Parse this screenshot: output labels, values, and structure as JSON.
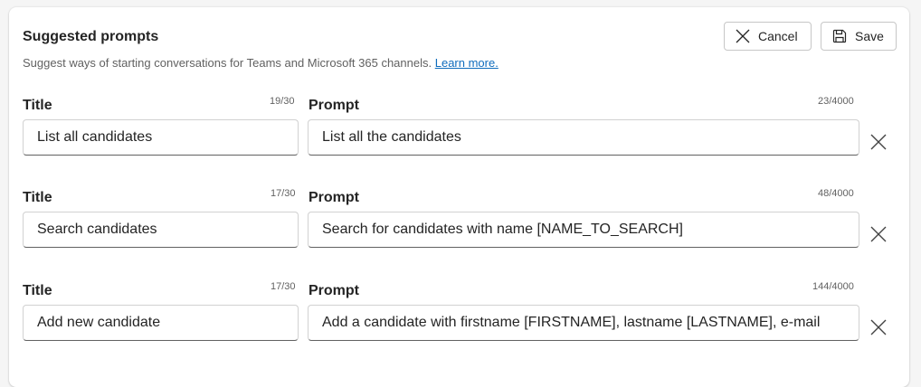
{
  "header": {
    "title": "Suggested prompts",
    "description": "Suggest ways of starting conversations for Teams and Microsoft 365 channels.",
    "learn_more": "Learn more.",
    "cancel_label": "Cancel",
    "save_label": "Save"
  },
  "prompts": [
    {
      "title_label": "Title",
      "title_count": "19/30",
      "title_value": "List all candidates",
      "prompt_label": "Prompt",
      "prompt_count": "23/4000",
      "prompt_value": "List all the candidates"
    },
    {
      "title_label": "Title",
      "title_count": "17/30",
      "title_value": "Search candidates",
      "prompt_label": "Prompt",
      "prompt_count": "48/4000",
      "prompt_value": "Search for candidates with name [NAME_TO_SEARCH]"
    },
    {
      "title_label": "Title",
      "title_count": "17/30",
      "title_value": "Add new candidate",
      "prompt_label": "Prompt",
      "prompt_count": "144/4000",
      "prompt_value": "Add a candidate with firstname [FIRSTNAME], lastname [LASTNAME],  e-mail"
    }
  ],
  "icons": {
    "cancel": "close-icon",
    "save": "save-icon",
    "remove": "close-icon"
  },
  "colors": {
    "link": "#0f6cbd",
    "text": "#242424",
    "muted": "#616161"
  }
}
